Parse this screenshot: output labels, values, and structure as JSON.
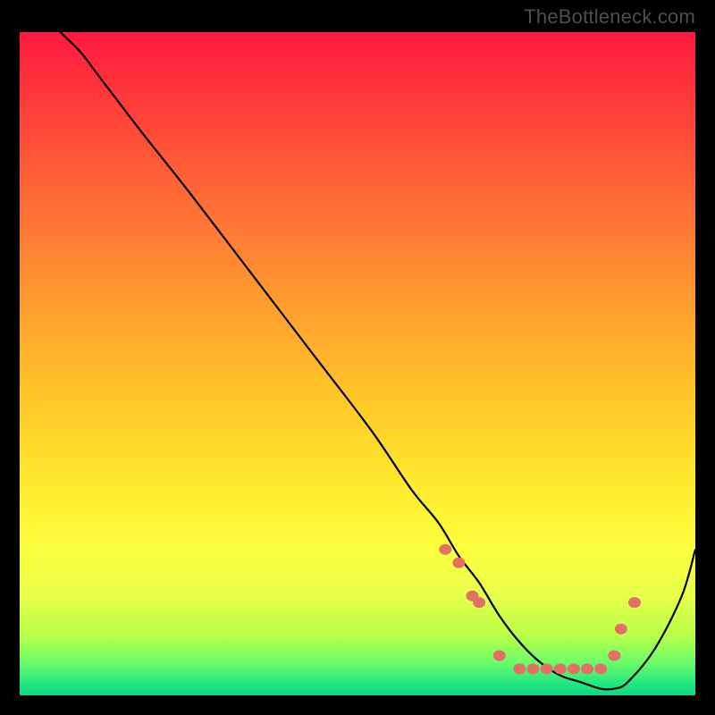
{
  "watermark": "TheBottleneck.com",
  "chart_data": {
    "type": "line",
    "title": "",
    "xlabel": "",
    "ylabel": "",
    "xlim": [
      0,
      100
    ],
    "ylim": [
      0,
      100
    ],
    "gradient_stops": [
      {
        "pct": 0,
        "color": "#ff1940"
      },
      {
        "pct": 10,
        "color": "#ff3a3a"
      },
      {
        "pct": 25,
        "color": "#ff6a36"
      },
      {
        "pct": 40,
        "color": "#ff9a30"
      },
      {
        "pct": 55,
        "color": "#ffc629"
      },
      {
        "pct": 68,
        "color": "#ffe92e"
      },
      {
        "pct": 78,
        "color": "#fbff3e"
      },
      {
        "pct": 85,
        "color": "#e6ff4a"
      },
      {
        "pct": 91,
        "color": "#b8ff4a"
      },
      {
        "pct": 95,
        "color": "#6efc68"
      },
      {
        "pct": 98,
        "color": "#28e97e"
      },
      {
        "pct": 100,
        "color": "#0fd885"
      }
    ],
    "series": [
      {
        "name": "curve",
        "x": [
          6,
          9,
          12,
          18,
          25,
          34,
          43,
          52,
          58,
          62,
          65,
          68,
          71,
          74,
          77,
          80,
          83,
          86,
          88,
          90,
          94,
          98,
          100
        ],
        "y": [
          100,
          97,
          93,
          85,
          76,
          64,
          52,
          40,
          31,
          26,
          21,
          17,
          12,
          8,
          5,
          3,
          2,
          1,
          1,
          2,
          7,
          15,
          22
        ]
      }
    ],
    "markers": [
      {
        "x": 63,
        "y": 22
      },
      {
        "x": 65,
        "y": 20
      },
      {
        "x": 67,
        "y": 15
      },
      {
        "x": 68,
        "y": 14
      },
      {
        "x": 71,
        "y": 6
      },
      {
        "x": 74,
        "y": 4
      },
      {
        "x": 76,
        "y": 4
      },
      {
        "x": 78,
        "y": 4
      },
      {
        "x": 80,
        "y": 4
      },
      {
        "x": 82,
        "y": 4
      },
      {
        "x": 84,
        "y": 4
      },
      {
        "x": 86,
        "y": 4
      },
      {
        "x": 88,
        "y": 6
      },
      {
        "x": 89,
        "y": 10
      },
      {
        "x": 91,
        "y": 14
      }
    ],
    "marker_color": "#e37066",
    "curve_color": "#000000"
  }
}
